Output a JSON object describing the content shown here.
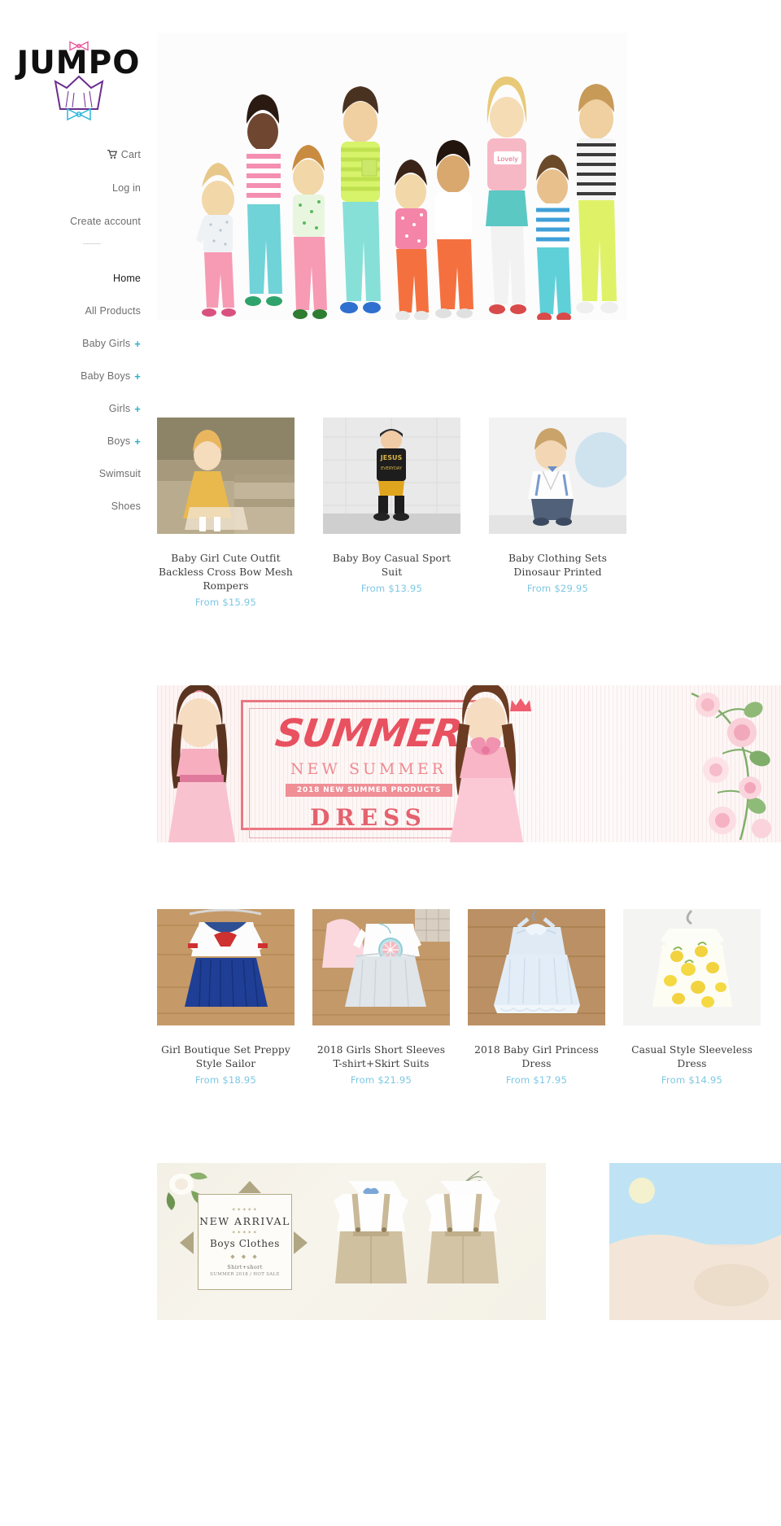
{
  "brand": {
    "name": "JUMPO",
    "logo_icons": [
      "pink-bow-icon",
      "purple-dress-icon",
      "blue-bow-icon"
    ]
  },
  "sidebar": {
    "account_links": [
      {
        "label": "Cart",
        "icon": "shopping-cart-icon"
      },
      {
        "label": "Log in",
        "icon": ""
      },
      {
        "label": "Create account",
        "icon": ""
      }
    ],
    "nav_items": [
      {
        "label": "Home",
        "expandable": false,
        "active": true
      },
      {
        "label": "All Products",
        "expandable": false,
        "active": false
      },
      {
        "label": "Baby Girls",
        "expandable": true,
        "active": false
      },
      {
        "label": "Baby Boys",
        "expandable": true,
        "active": false
      },
      {
        "label": "Girls",
        "expandable": true,
        "active": false
      },
      {
        "label": "Boys",
        "expandable": true,
        "active": false
      },
      {
        "label": "Swimsuit",
        "expandable": false,
        "active": false
      },
      {
        "label": "Shoes",
        "expandable": false,
        "active": false
      }
    ],
    "expand_symbol": "+",
    "expand_color": "#31b0c6"
  },
  "hero": {
    "alt": "group of children in colorful kids clothing"
  },
  "products_row1": [
    {
      "title": "Baby Girl Cute Outfit Backless Cross Bow Mesh Rompers",
      "price": "From $15.95"
    },
    {
      "title": "Baby Boy Casual Sport Suit",
      "price": "From $13.95"
    },
    {
      "title": "Baby Clothing Sets Dinosaur Printed",
      "price": "From $29.95"
    }
  ],
  "products_row2": [
    {
      "title": "Girl Boutique Set Preppy Style Sailor",
      "price": "From $18.95"
    },
    {
      "title": "2018 Girls Short Sleeves T-shirt+Skirt Suits",
      "price": "From $21.95"
    },
    {
      "title": "2018 Baby Girl Princess Dress",
      "price": "From $17.95"
    },
    {
      "title": "Casual Style Sleeveless Dress",
      "price": "From $14.95"
    }
  ],
  "banner_summer": {
    "headline": "SUMMER",
    "subhead": "NEW SUMMER",
    "badge": "2018 NEW SUMMER PRODUCTS",
    "footline": "DRESS",
    "accent_color": "#e8515f"
  },
  "banner_arrival": {
    "dots_top": "✶✶✶✶✶",
    "title": "NEW  ARRIVAL",
    "dots_mid": "✶✶✶✶✶",
    "subtitle": "Boys  Clothes",
    "diamonds": "◆ ◆ ◆",
    "line1": "Shirt+short",
    "line2": "SUMMER 2018 / HOT SALE"
  },
  "colors": {
    "price": "#7ec8e3",
    "nav_text": "#6e6e6e",
    "nav_active": "#1b1b1b"
  }
}
